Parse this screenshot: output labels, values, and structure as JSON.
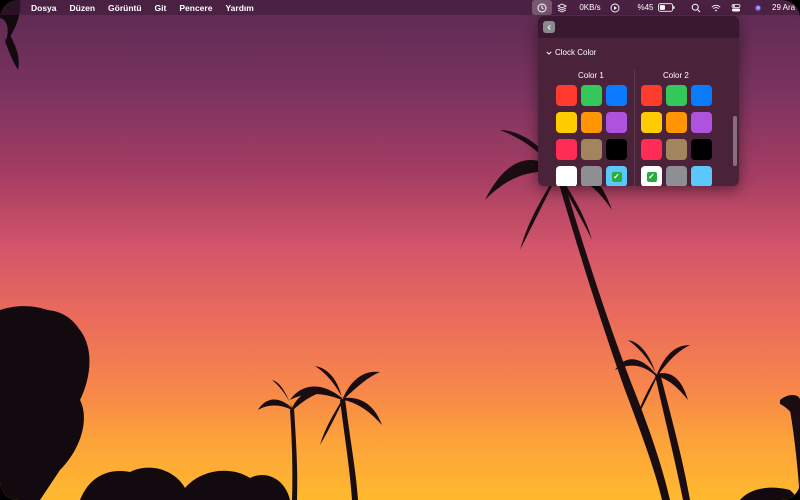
{
  "menubar": {
    "items": [
      "Dosya",
      "Düzen",
      "Görüntü",
      "Git",
      "Pencere",
      "Yardım"
    ],
    "network_speed": "0KB/s",
    "battery_percent": "%45",
    "battery_level": 0.45,
    "date": "29 Ara"
  },
  "popover": {
    "section_title": "Clock Color",
    "color1_title": "Color 1",
    "color2_title": "Color 2",
    "swatch_colors": [
      [
        "#ff3b30",
        "#34c759",
        "#0a7aff"
      ],
      [
        "#ffcc00",
        "#ff9500",
        "#af52de"
      ],
      [
        "#ff2d55",
        "#a2845e",
        "#000000"
      ],
      [
        "#ffffff",
        "#8e8e93",
        "#5ac8fa"
      ]
    ],
    "color1_selected": "#5ac8fa",
    "color2_selected": "#ffffff",
    "check_glyph": "✓"
  },
  "icons": [
    "clock-icon",
    "layers-icon",
    "play-icon",
    "battery-icon",
    "search-icon",
    "wifi-icon",
    "control-center-icon",
    "siri-icon",
    "back-icon",
    "chevron-down-icon"
  ]
}
